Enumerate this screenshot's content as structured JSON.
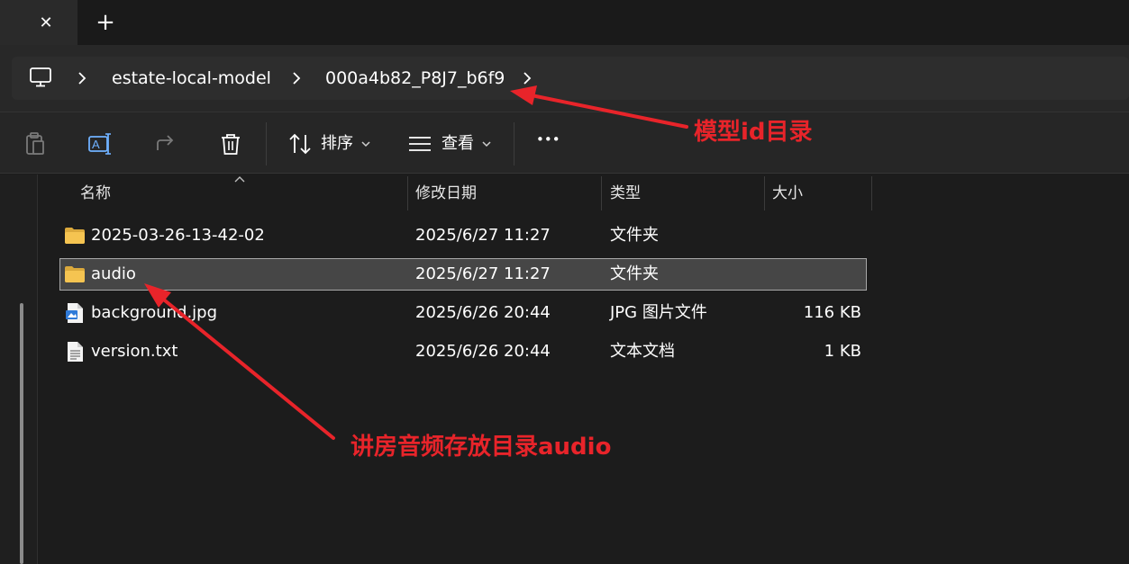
{
  "tabs": {
    "close_glyph": "✕",
    "new_tab_glyph": "+"
  },
  "address": {
    "icon": "computer-icon",
    "crumbs": [
      "estate-local-model",
      "000a4b82_P8J7_b6f9"
    ]
  },
  "toolbar": {
    "icons": [
      "paste-icon",
      "rename-icon",
      "share-icon",
      "delete-icon"
    ],
    "sort_label": "排序",
    "view_label": "查看",
    "more_glyph": "•••"
  },
  "columns": {
    "name": "名称",
    "modified": "修改日期",
    "type": "类型",
    "size": "大小"
  },
  "files": [
    {
      "name": "2025-03-26-13-42-02",
      "modified": "2025/6/27 11:27",
      "type": "文件夹",
      "size": "",
      "icon": "folder-icon"
    },
    {
      "name": "audio",
      "modified": "2025/6/27 11:27",
      "type": "文件夹",
      "size": "",
      "icon": "folder-icon",
      "selected": true
    },
    {
      "name": "background.jpg",
      "modified": "2025/6/26 20:44",
      "type": "JPG 图片文件",
      "size": "116 KB",
      "icon": "image-file-icon"
    },
    {
      "name": "version.txt",
      "modified": "2025/6/26 20:44",
      "type": "文本文档",
      "size": "1 KB",
      "icon": "text-file-icon"
    }
  ],
  "annotations": {
    "model_dir": "模型id目录",
    "audio_dir": "讲房音频存放目录audio"
  },
  "colors": {
    "annotation": "#e8242a",
    "folder": "#f5c451",
    "selection": "#464646"
  }
}
